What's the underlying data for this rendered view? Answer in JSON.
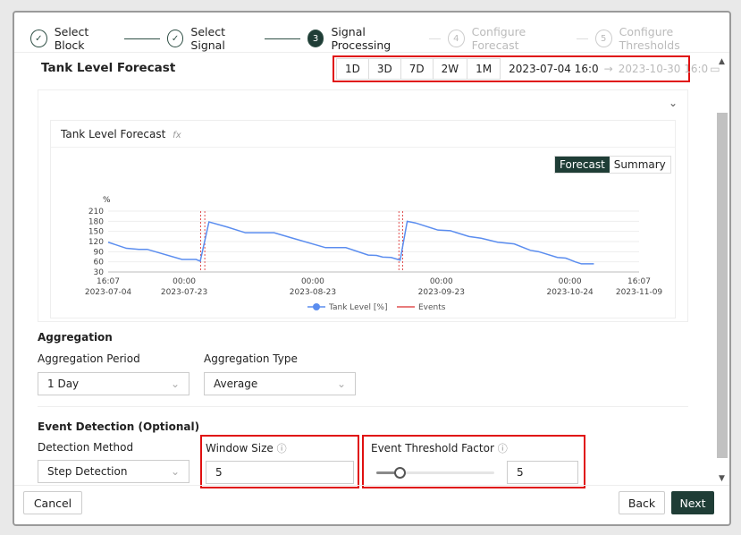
{
  "stepper": [
    {
      "label": "Select Block",
      "state": "done"
    },
    {
      "label": "Select Signal",
      "state": "done"
    },
    {
      "label": "Signal Processing",
      "state": "active",
      "num": "3"
    },
    {
      "label": "Configure Forecast",
      "state": "pending",
      "num": "4"
    },
    {
      "label": "Configure Thresholds",
      "state": "pending",
      "num": "5"
    }
  ],
  "header": {
    "title": "Tank Level Forecast",
    "ranges": [
      "1D",
      "3D",
      "7D",
      "2W",
      "1M"
    ],
    "start": "2023-07-04 16:0",
    "end": "2023-10-30 16:0"
  },
  "chart_card": {
    "title": "Tank Level Forecast",
    "fx": "fx",
    "toggle": [
      "Forecast",
      "Summary"
    ]
  },
  "chart_data": {
    "type": "line",
    "title": "Tank Level Forecast",
    "ylabel": "%",
    "ylim": [
      30,
      210
    ],
    "yticks": [
      30,
      60,
      90,
      120,
      150,
      180,
      210
    ],
    "x_unit": "days since 2023-07-04 16:07",
    "xlim": [
      0,
      128
    ],
    "xticks": [
      {
        "d": 0,
        "t": "16:07",
        "date": "2023-07-04"
      },
      {
        "d": 18.33,
        "t": "00:00",
        "date": "2023-07-23"
      },
      {
        "d": 49.33,
        "t": "00:00",
        "date": "2023-08-23"
      },
      {
        "d": 80.33,
        "t": "00:00",
        "date": "2023-09-23"
      },
      {
        "d": 111.33,
        "t": "00:00",
        "date": "2023-10-24"
      },
      {
        "d": 128,
        "t": "16:07",
        "date": "2023-11-09"
      }
    ],
    "series": [
      {
        "name": "Tank Level [%]",
        "color": "#5b8def",
        "x": [
          0,
          4.4,
          7.4,
          9.4,
          17.8,
          21.2,
          22.2,
          24.3,
          28.7,
          33.1,
          40,
          44.5,
          52.4,
          57.3,
          62.7,
          64.7,
          66.2,
          68.2,
          70.4,
          72.1,
          74.1,
          79.5,
          82.5,
          87,
          89.9,
          93.9,
          97.9,
          101.8,
          103.8,
          108.3,
          110.3,
          112.6,
          114.1,
          117.1
        ],
        "y": [
          118,
          100,
          97,
          97,
          67,
          67,
          62,
          178,
          163,
          146,
          146,
          130,
          102,
          102,
          80,
          79,
          74,
          73,
          65,
          180,
          175,
          154,
          152,
          135,
          130,
          118,
          113,
          94,
          90,
          73,
          71,
          60,
          54,
          54
        ]
      }
    ],
    "events": {
      "name": "Events",
      "color": "#e05050",
      "x": [
        22.3,
        23.3,
        70.1,
        71.0
      ]
    },
    "legend": [
      "Tank Level [%]",
      "Events"
    ]
  },
  "aggregation": {
    "title": "Aggregation",
    "period_label": "Aggregation Period",
    "period": "1 Day",
    "type_label": "Aggregation Type",
    "type": "Average"
  },
  "event_detection": {
    "title": "Event Detection (Optional)",
    "method_label": "Detection Method",
    "method": "Step Detection",
    "window_label": "Window Size",
    "window": "5",
    "threshold_label": "Event Threshold Factor",
    "threshold": "5",
    "slider_fraction": 0.2
  },
  "footer": {
    "cancel": "Cancel",
    "back": "Back",
    "next": "Next"
  }
}
